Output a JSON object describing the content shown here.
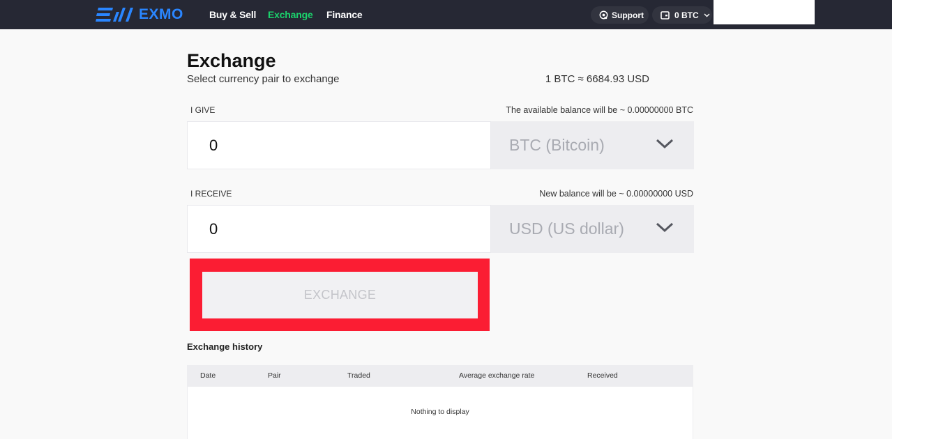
{
  "header": {
    "logo_text": "EXMO",
    "nav": [
      "Buy & Sell",
      "Exchange",
      "Finance"
    ],
    "active_nav": "Exchange",
    "support_label": "Support",
    "wallet_label": "0 BTC"
  },
  "page": {
    "title": "Exchange",
    "subtitle": "Select currency pair to exchange",
    "rate": "1 BTC ≈ 6684.93 USD"
  },
  "give": {
    "label": "I GIVE",
    "balance_note": "The available balance will be ~ 0.00000000 BTC",
    "amount": "0",
    "currency": "BTC (Bitcoin)"
  },
  "receive": {
    "label": "I RECEIVE",
    "balance_note": "New balance will be ~ 0.00000000 USD",
    "amount": "0",
    "currency": "USD (US dollar)"
  },
  "exchange_button": "EXCHANGE",
  "history": {
    "title": "Exchange history",
    "columns": [
      "Date",
      "Pair",
      "Traded",
      "Average exchange rate",
      "Received"
    ],
    "empty_text": "Nothing to display"
  },
  "colors": {
    "topbar": "#262834",
    "accent_green": "#1bd36c",
    "logo_blue": "#2a86ff",
    "highlight_red": "#fb1d33"
  }
}
